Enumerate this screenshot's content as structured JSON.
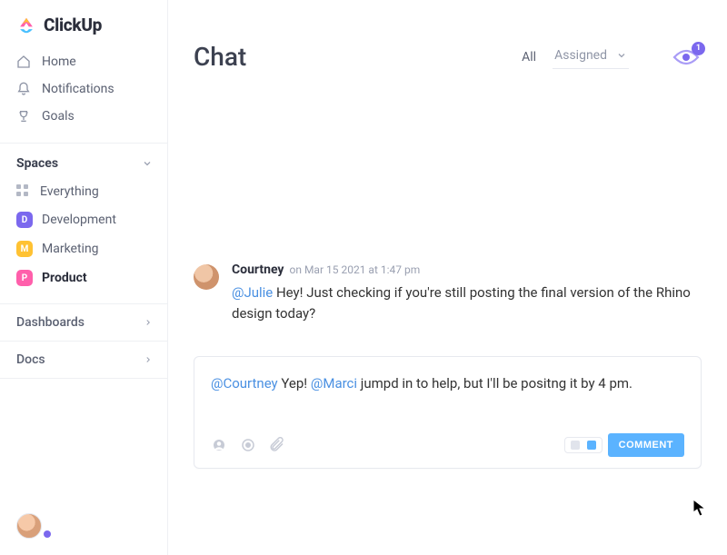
{
  "brand": {
    "name": "ClickUp"
  },
  "nav": {
    "items": [
      {
        "label": "Home",
        "icon": "home-icon"
      },
      {
        "label": "Notifications",
        "icon": "bell-icon"
      },
      {
        "label": "Goals",
        "icon": "trophy-icon"
      }
    ]
  },
  "spaces": {
    "heading": "Spaces",
    "everything_label": "Everything",
    "items": [
      {
        "label": "Development",
        "badge": "D",
        "color": "#7b68ee"
      },
      {
        "label": "Marketing",
        "badge": "M",
        "color": "#ffc233"
      },
      {
        "label": "Product",
        "badge": "P",
        "color": "#ff5fab",
        "active": true
      }
    ]
  },
  "sections": {
    "dashboards": "Dashboards",
    "docs": "Docs"
  },
  "header": {
    "title": "Chat",
    "filter_all": "All",
    "filter_assigned": "Assigned",
    "watcher_count": "1"
  },
  "message": {
    "author": "Courtney",
    "meta_prefix": "on",
    "meta_date": "Mar 15 2021 at 1:47 pm",
    "mention": "@Julie",
    "text_after_mention": " Hey! Just checking if you're still posting the final version of the Rhino design today?"
  },
  "composer": {
    "mention1": "@Courtney",
    "text1": " Yep! ",
    "mention2": "@Marci",
    "text2": " jumpd in to help, but I'll be positng it by 4 pm.",
    "submit_label": "COMMENT"
  }
}
